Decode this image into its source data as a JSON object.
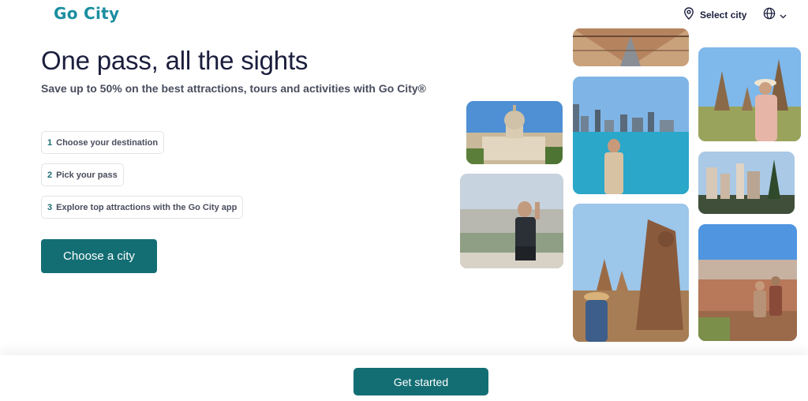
{
  "header": {
    "logo_text": "Go City",
    "select_city_label": "Select city"
  },
  "hero": {
    "title": "One pass, all the sights",
    "subtitle": "Save up to 50% on the best attractions, tours and activities with Go City®"
  },
  "steps": [
    {
      "num": "1",
      "label": "Choose your destination"
    },
    {
      "num": "2",
      "label": "Pick your pass"
    },
    {
      "num": "3",
      "label": "Explore top attractions with the Go City app"
    }
  ],
  "cta_label": "Choose a city",
  "footer": {
    "get_started_label": "Get started"
  },
  "colors": {
    "brand_teal": "#136e74",
    "logo_teal": "#1b8ea0",
    "heading": "#1b1e3d"
  }
}
